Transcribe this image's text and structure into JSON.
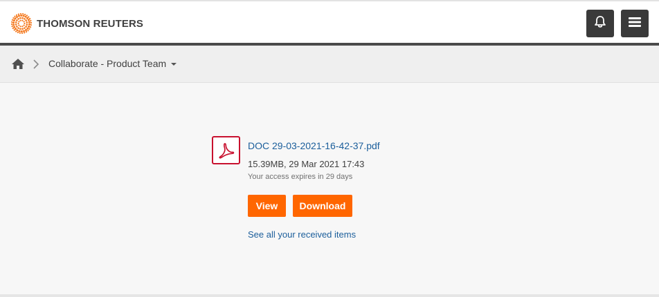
{
  "header": {
    "brand": "THOMSON REUTERS",
    "logo_icon": "thomson-reuters-logo-icon",
    "notifications_icon": "bell-icon",
    "menu_icon": "hamburger-menu-icon",
    "button_color": "#3a3a3a"
  },
  "breadcrumb": {
    "home_icon": "home-icon",
    "separator_icon": "chevron-right-icon",
    "current": "Collaborate - Product Team",
    "dropdown_icon": "caret-down-icon"
  },
  "file": {
    "type_icon": "pdf-icon",
    "name": "DOC 29-03-2021-16-42-37.pdf",
    "meta": "15.39MB, 29 Mar 2021 17:43",
    "expiry": "Your access expires in 29 days"
  },
  "actions": {
    "view_label": "View",
    "download_label": "Download",
    "accent_color": "#ff6600"
  },
  "links": {
    "received": "See all your received items",
    "link_color": "#1b5e9b"
  }
}
